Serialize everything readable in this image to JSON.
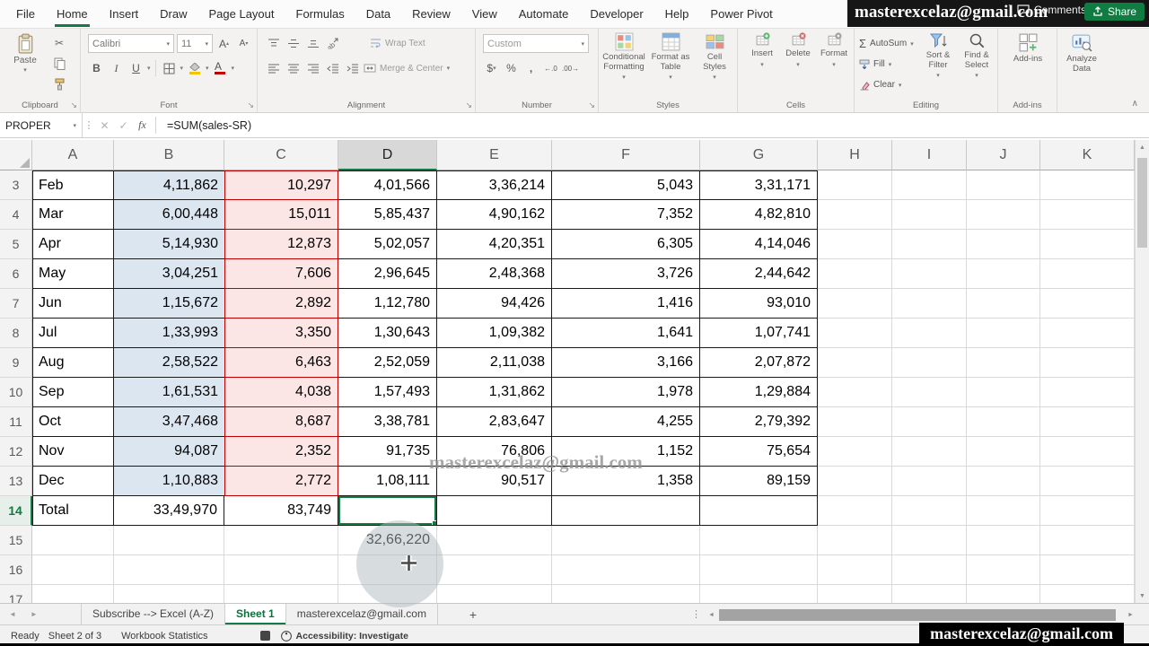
{
  "colors": {
    "excel_green": "#107c41",
    "col_b_fill": "#dce6f1",
    "col_c_fill": "#fbe5e5",
    "col_c_border": "#c00000"
  },
  "icons": {
    "dd": "▾",
    "cut": "✂",
    "launcher": "↘",
    "collapse": "∧",
    "sigma": "Σ",
    "percent": "%",
    "comma": ",",
    "currency": "$",
    "increase_decimal": "←.0",
    "decrease_decimal": ".00→",
    "cancel": "✕",
    "enter": "✓",
    "fx": "fx",
    "add_sheet": "+",
    "splitter": "⋮",
    "scroll_up": "▲",
    "scroll_down": "▼",
    "scroll_left": "◄",
    "scroll_right": "►",
    "tab_nav_left": "◄",
    "tab_nav_right": "►",
    "grow_font": "A",
    "shrink_font": "A"
  },
  "titlebar": {
    "watermark": "masterexcelaz@gmail.com",
    "comments": "Comments",
    "share": "Share"
  },
  "menu": {
    "tabs": [
      "File",
      "Home",
      "Insert",
      "Draw",
      "Page Layout",
      "Formulas",
      "Data",
      "Review",
      "View",
      "Automate",
      "Developer",
      "Help",
      "Power Pivot"
    ],
    "active": "Home"
  },
  "ribbon": {
    "clipboard": {
      "label": "Clipboard",
      "paste": "Paste"
    },
    "font": {
      "label": "Font",
      "font_name": "Calibri",
      "font_size": "11",
      "bold": "B",
      "italic": "I",
      "underline": "U"
    },
    "alignment": {
      "label": "Alignment",
      "wrap_text": "Wrap Text",
      "merge_center": "Merge & Center"
    },
    "number": {
      "label": "Number",
      "format": "Custom"
    },
    "styles": {
      "label": "Styles",
      "conditional": "Conditional Formatting",
      "format_table": "Format as Table",
      "cell_styles": "Cell Styles"
    },
    "cells": {
      "label": "Cells",
      "insert": "Insert",
      "delete": "Delete",
      "format": "Format"
    },
    "editing": {
      "label": "Editing",
      "autosum": "AutoSum",
      "fill": "Fill",
      "clear": "Clear",
      "sort_filter": "Sort & Filter",
      "find_select": "Find & Select"
    },
    "addins": {
      "label": "Add-ins",
      "addins": "Add-ins",
      "analyze": "Analyze Data"
    }
  },
  "formula_bar": {
    "name_box": "PROPER",
    "formula": "=SUM(sales-SR)"
  },
  "grid": {
    "selected_cell": "D14",
    "watermark": "masterexcelaz@gmail.com",
    "columns": [
      "A",
      "B",
      "C",
      "D",
      "E",
      "F",
      "G",
      "H",
      "I",
      "J",
      "K"
    ],
    "rows": [
      {
        "num": "3",
        "A": "Feb",
        "B": "4,11,862",
        "C": "10,297",
        "D": "4,01,566",
        "E": "3,36,214",
        "F": "5,043",
        "G": "3,31,171"
      },
      {
        "num": "4",
        "A": "Mar",
        "B": "6,00,448",
        "C": "15,011",
        "D": "5,85,437",
        "E": "4,90,162",
        "F": "7,352",
        "G": "4,82,810"
      },
      {
        "num": "5",
        "A": "Apr",
        "B": "5,14,930",
        "C": "12,873",
        "D": "5,02,057",
        "E": "4,20,351",
        "F": "6,305",
        "G": "4,14,046"
      },
      {
        "num": "6",
        "A": "May",
        "B": "3,04,251",
        "C": "7,606",
        "D": "2,96,645",
        "E": "2,48,368",
        "F": "3,726",
        "G": "2,44,642"
      },
      {
        "num": "7",
        "A": "Jun",
        "B": "1,15,672",
        "C": "2,892",
        "D": "1,12,780",
        "E": "94,426",
        "F": "1,416",
        "G": "93,010"
      },
      {
        "num": "8",
        "A": "Jul",
        "B": "1,33,993",
        "C": "3,350",
        "D": "1,30,643",
        "E": "1,09,382",
        "F": "1,641",
        "G": "1,07,741"
      },
      {
        "num": "9",
        "A": "Aug",
        "B": "2,58,522",
        "C": "6,463",
        "D": "2,52,059",
        "E": "2,11,038",
        "F": "3,166",
        "G": "2,07,872"
      },
      {
        "num": "10",
        "A": "Sep",
        "B": "1,61,531",
        "C": "4,038",
        "D": "1,57,493",
        "E": "1,31,862",
        "F": "1,978",
        "G": "1,29,884"
      },
      {
        "num": "11",
        "A": "Oct",
        "B": "3,47,468",
        "C": "8,687",
        "D": "3,38,781",
        "E": "2,83,647",
        "F": "4,255",
        "G": "2,79,392"
      },
      {
        "num": "12",
        "A": "Nov",
        "B": "94,087",
        "C": "2,352",
        "D": "91,735",
        "E": "76,806",
        "F": "1,152",
        "G": "75,654"
      },
      {
        "num": "13",
        "A": "Dec",
        "B": "1,10,883",
        "C": "2,772",
        "D": "1,08,111",
        "E": "90,517",
        "F": "1,358",
        "G": "89,159"
      },
      {
        "num": "14",
        "A": "Total",
        "B": "33,49,970",
        "C": "83,749",
        "D": "",
        "E": "",
        "F": "",
        "G": ""
      },
      {
        "num": "15",
        "D": "32,66,220"
      },
      {
        "num": "16"
      },
      {
        "num": "17"
      }
    ]
  },
  "sheet_bar": {
    "tabs": [
      {
        "label": "Subscribe --> Excel (A-Z)",
        "active": false
      },
      {
        "label": "Sheet 1",
        "active": true
      },
      {
        "label": "masterexcelaz@gmail.com",
        "active": false
      }
    ]
  },
  "status_bar": {
    "ready": "Ready",
    "sheet_info": "Sheet 2 of 3",
    "workbook_stats": "Workbook Statistics",
    "accessibility": "Accessibility: Investigate",
    "watermark": "masterexcelaz@gmail.com"
  }
}
